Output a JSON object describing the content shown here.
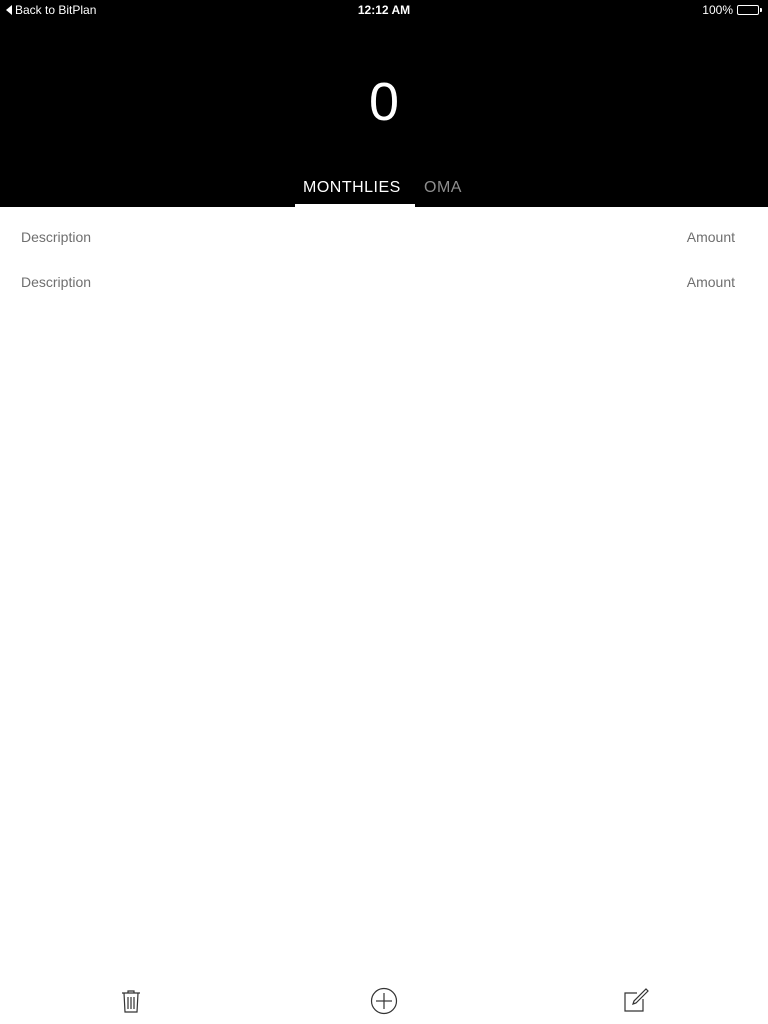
{
  "status_bar": {
    "back_label": "Back to BitPlan",
    "time": "12:12 AM",
    "battery_percent": "100%"
  },
  "header": {
    "total": "0"
  },
  "tabs": [
    {
      "label": "MONTHLIES",
      "active": true
    },
    {
      "label": "OMA",
      "active": false
    }
  ],
  "rows": [
    {
      "description_placeholder": "Description",
      "amount_placeholder": "Amount"
    },
    {
      "description_placeholder": "Description",
      "amount_placeholder": "Amount"
    }
  ],
  "toolbar": {
    "icons": [
      "trash-icon",
      "add-circle-icon",
      "compose-icon"
    ]
  },
  "colors": {
    "header_bg": "#000000",
    "active_tab": "#ffffff",
    "inactive_tab": "#8e8e8e",
    "row_text": "#6f6f6f"
  }
}
